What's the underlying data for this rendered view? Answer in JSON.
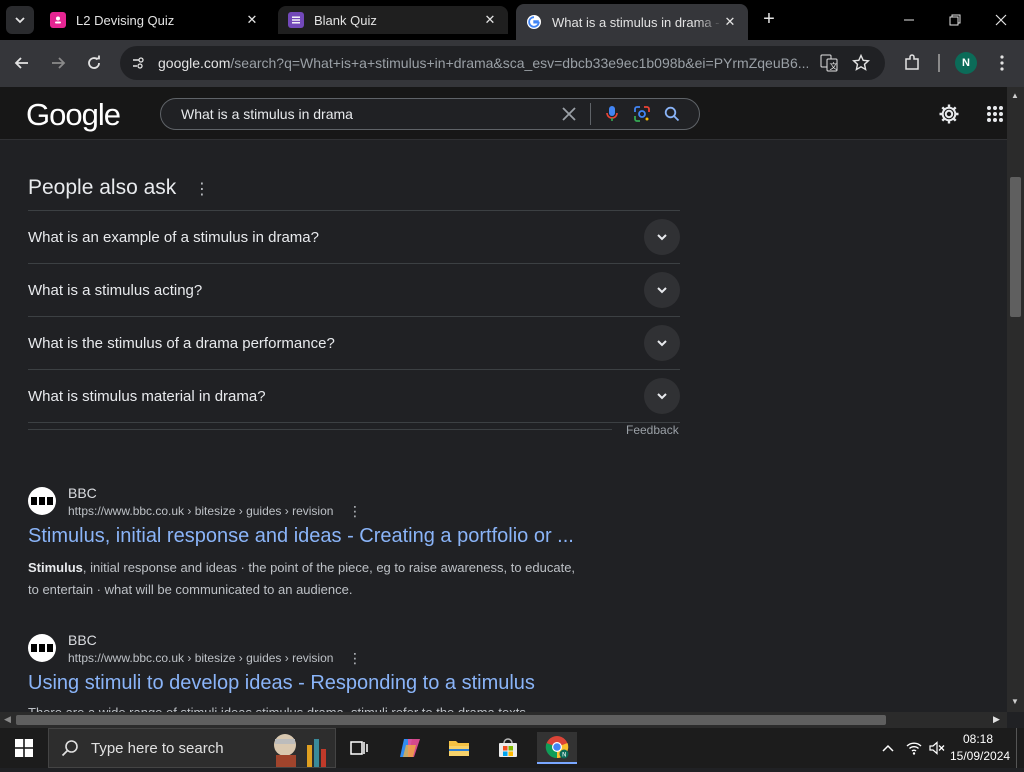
{
  "tabs": [
    {
      "title": "L2 Devising Quiz",
      "favicon": "forms-icon",
      "color": "#e52592"
    },
    {
      "title": "Blank Quiz",
      "favicon": "forms-list-icon",
      "color": "#7248b9"
    },
    {
      "title": "What is a stimulus in drama - Go",
      "favicon": "google-icon",
      "active": true
    }
  ],
  "omnibox": {
    "domain": "google.com",
    "path": "/search?q=What+is+a+stimulus+in+drama&sca_esv=dbcb33e9ec1b098b&ei=PYrmZqeuB6..."
  },
  "profile": {
    "initial": "N"
  },
  "search": {
    "logo": "Google",
    "query": "What is a stimulus in drama"
  },
  "paa": {
    "title": "People also ask",
    "questions": [
      "What is an example of a stimulus in drama?",
      "What is a stimulus acting?",
      "What is the stimulus of a drama performance?",
      "What is stimulus material in drama?"
    ],
    "feedback": "Feedback"
  },
  "results": [
    {
      "site": "BBC",
      "url": "https://www.bbc.co.uk › bitesize › guides › revision",
      "title": "Stimulus, initial response and ideas - Creating a portfolio or ...",
      "snippet_bold": "Stimulus",
      "snippet": ", initial response and ideas · the point of the piece, eg to raise awareness, to educate, to entertain · what will be communicated to an audience."
    },
    {
      "site": "BBC",
      "url": "https://www.bbc.co.uk › bitesize › guides › revision",
      "title": "Using stimuli to develop ideas - Responding to a stimulus",
      "snippet": "There are a wide range of stimuli ideas stimulus drama, stimuli refer to the drama texts"
    }
  ],
  "taskbar": {
    "search_placeholder": "Type here to search",
    "time": "08:18",
    "date": "15/09/2024"
  }
}
